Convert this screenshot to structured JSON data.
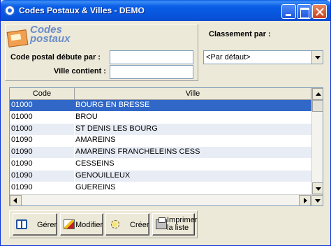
{
  "window": {
    "title": "Codes Postaux & Villes - DEMO"
  },
  "logo": {
    "line1": "Codes",
    "line2": "postaux"
  },
  "filters": {
    "code_label": "Code postal débute par :",
    "code_value": "",
    "ville_label": "Ville contient :",
    "ville_value": ""
  },
  "sort": {
    "label": "Classement par :",
    "selected": "<Par défaut>"
  },
  "grid": {
    "columns": [
      "Code",
      "Ville"
    ],
    "rows": [
      {
        "code": "01000",
        "ville": "BOURG EN BRESSE",
        "selected": true
      },
      {
        "code": "01000",
        "ville": "BROU"
      },
      {
        "code": "01000",
        "ville": "ST DENIS LES BOURG"
      },
      {
        "code": "01090",
        "ville": "AMAREINS"
      },
      {
        "code": "01090",
        "ville": "AMAREINS FRANCHELEINS CESS"
      },
      {
        "code": "01090",
        "ville": "CESSEINS"
      },
      {
        "code": "01090",
        "ville": "GENOUILLEUX"
      },
      {
        "code": "01090",
        "ville": "GUEREINS"
      }
    ]
  },
  "toolbar": {
    "gerer": "Gérer",
    "modifier": "Modifier",
    "creer": "Créer",
    "imprimer_line1": "Imprimer",
    "imprimer_line2": "la liste"
  },
  "colors": {
    "titlebar": "#0a5ee6",
    "selection": "#3168c8",
    "row_alt": "#e8ecf5"
  }
}
